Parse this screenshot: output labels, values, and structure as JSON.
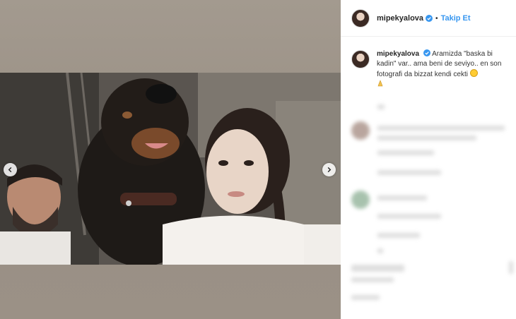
{
  "post": {
    "username": "mipekyalova",
    "follow_label": "Takip Et",
    "dot": "•",
    "caption": "Aramizda \"baska bi kadin\" var.. ama beni de seviyo.. en son fotografi da bizzat kendi cekti"
  },
  "icons": {
    "verified": "verified-badge-icon",
    "prev": "chevron-left-icon",
    "next": "chevron-right-icon"
  },
  "colors": {
    "accent": "#3897f0",
    "text": "#262626",
    "media_bg": "#9e958a"
  }
}
